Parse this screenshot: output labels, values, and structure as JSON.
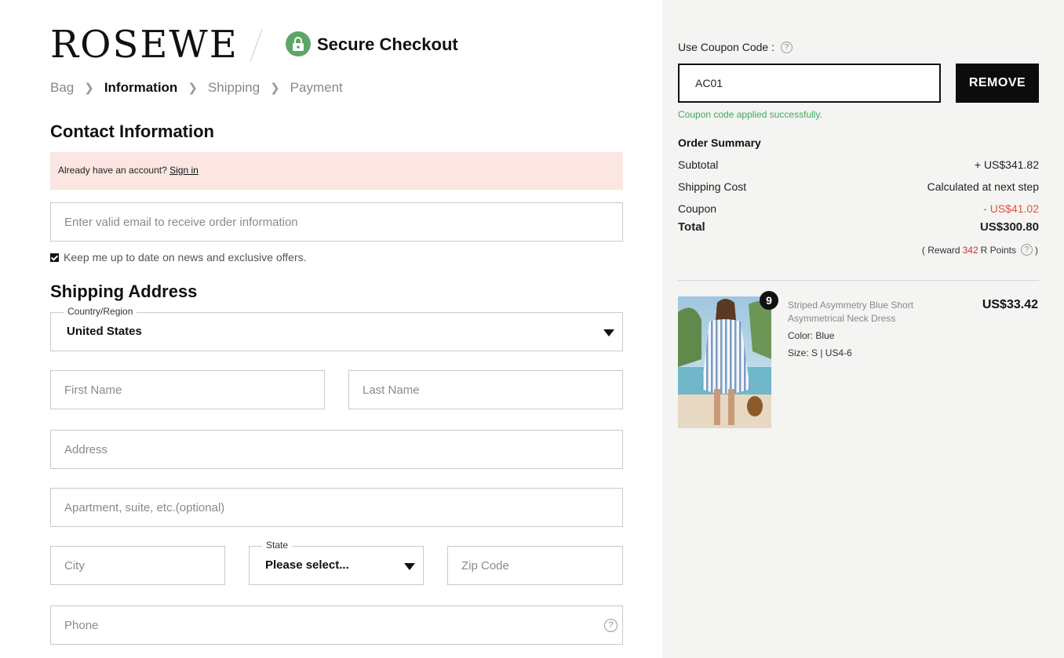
{
  "header": {
    "logo": "ROSEWE",
    "secure_title": "Secure Checkout"
  },
  "breadcrumb": [
    {
      "label": "Bag",
      "current": false
    },
    {
      "label": "Information",
      "current": true
    },
    {
      "label": "Shipping",
      "current": false
    },
    {
      "label": "Payment",
      "current": false
    }
  ],
  "contact": {
    "heading": "Contact Information",
    "account_text": "Already have an account?",
    "sign_in": "Sign in",
    "email_placeholder": "Enter valid email to receive order information",
    "keep_updated": "Keep me up to date on news and exclusive offers."
  },
  "shipping": {
    "heading": "Shipping Address",
    "country_label": "Country/Region",
    "country_value": "United States",
    "first_name_placeholder": "First Name",
    "last_name_placeholder": "Last Name",
    "address_placeholder": "Address",
    "apartment_placeholder": "Apartment, suite, etc.(optional)",
    "city_placeholder": "City",
    "state_label": "State",
    "state_value": "Please select...",
    "zip_placeholder": "Zip Code",
    "phone_placeholder": "Phone",
    "help": "?"
  },
  "coupon": {
    "label": "Use Coupon Code :",
    "help": "?",
    "code": "AC01",
    "remove_label": "REMOVE",
    "success": "Coupon code applied successfully."
  },
  "summary": {
    "title": "Order Summary",
    "subtotal_label": "Subtotal",
    "subtotal_value": "+ US$341.82",
    "shipping_label": "Shipping Cost",
    "shipping_value": "Calculated at next step",
    "coupon_label": "Coupon",
    "coupon_value": "- US$41.02",
    "total_label": "Total",
    "total_value": "US$300.80",
    "reward_prefix": "( Reward",
    "reward_points": "342",
    "reward_suffix": "R Points",
    "reward_help": "?",
    "reward_close": ")"
  },
  "product": {
    "quantity": "9",
    "name": "Striped Asymmetry Blue Short Asymmetrical Neck Dress",
    "price": "US$33.42",
    "color": "Color: Blue",
    "size": "Size: S | US4-6"
  },
  "colors": {
    "accent_green": "#5ca768",
    "success_green": "#3caa5a",
    "discount_red": "#e0533e",
    "alert_bg": "#fbe6e2",
    "panel_bg": "#f4f4f2"
  }
}
